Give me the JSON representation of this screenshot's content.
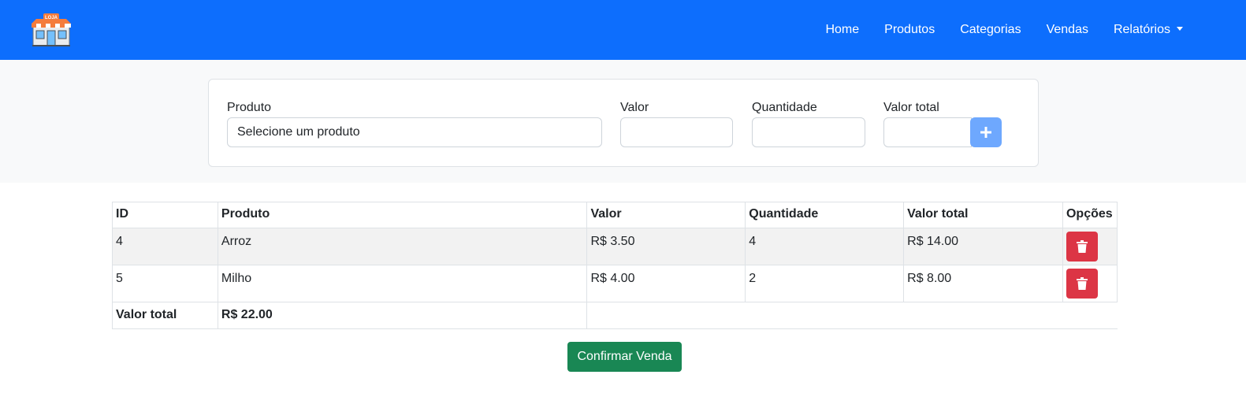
{
  "navbar": {
    "logo_text": "LOJA",
    "links": [
      {
        "label": "Home"
      },
      {
        "label": "Produtos"
      },
      {
        "label": "Categorias"
      },
      {
        "label": "Vendas"
      },
      {
        "label": "Relatórios",
        "dropdown": true
      }
    ],
    "brand_color": "#0d6efd"
  },
  "form": {
    "produto_label": "Produto",
    "produto_value": "Selecione um produto",
    "valor_label": "Valor",
    "valor_value": "",
    "quantidade_label": "Quantidade",
    "quantidade_value": "",
    "valor_total_label": "Valor total",
    "valor_total_value": "",
    "add_icon": "plus-icon"
  },
  "table": {
    "headers": [
      "ID",
      "Produto",
      "Valor",
      "Quantidade",
      "Valor total",
      "Opções"
    ],
    "rows": [
      {
        "id": "4",
        "produto": "Arroz",
        "valor": "R$ 3.50",
        "quantidade": "4",
        "valor_total": "R$ 14.00",
        "action_icon": "trash-icon"
      },
      {
        "id": "5",
        "produto": "Milho",
        "valor": "R$ 4.00",
        "quantidade": "2",
        "valor_total": "R$ 8.00",
        "action_icon": "trash-icon"
      }
    ],
    "total_label": "Valor total",
    "total_value": "R$ 22.00"
  },
  "confirm_label": "Confirmar Venda",
  "colors": {
    "danger": "#dc3545",
    "success": "#198754",
    "add_button": "#6ea8fe"
  }
}
